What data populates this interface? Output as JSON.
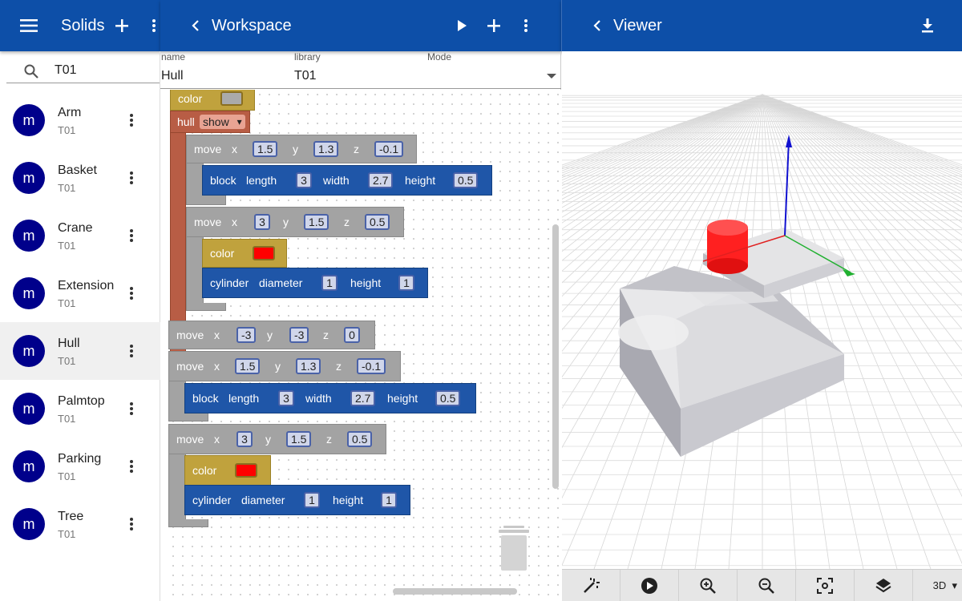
{
  "left": {
    "title": "Solids",
    "search_value": "T01",
    "items": [
      {
        "avatar": "m",
        "name": "Arm",
        "library": "T01"
      },
      {
        "avatar": "m",
        "name": "Basket",
        "library": "T01"
      },
      {
        "avatar": "m",
        "name": "Crane",
        "library": "T01"
      },
      {
        "avatar": "m",
        "name": "Extension",
        "library": "T01"
      },
      {
        "avatar": "m",
        "name": "Hull",
        "library": "T01"
      },
      {
        "avatar": "m",
        "name": "Palmtop",
        "library": "T01"
      },
      {
        "avatar": "m",
        "name": "Parking",
        "library": "T01"
      },
      {
        "avatar": "m",
        "name": "Tree",
        "library": "T01"
      }
    ],
    "selected_item": "Hull"
  },
  "workspace": {
    "title": "Workspace",
    "fields": {
      "name_label": "name",
      "name_value": "Hull",
      "library_label": "library",
      "library_value": "T01",
      "mode_label": "Mode",
      "mode_value": ""
    },
    "blocks": {
      "color": "color",
      "hull": "hull",
      "hull_option": "show",
      "move": "move",
      "block": "block",
      "cylinder": "cylinder",
      "x": "x",
      "y": "y",
      "z": "z",
      "length": "length",
      "width": "width",
      "height": "height",
      "diameter": "diameter",
      "m1": {
        "x": "1.5",
        "y": "1.3",
        "z": "-0.1"
      },
      "b1": {
        "length": "3",
        "width": "2.7",
        "height": "0.5"
      },
      "m2": {
        "x": "3",
        "y": "1.5",
        "z": "0.5"
      },
      "c1": {
        "diameter": "1",
        "height": "1"
      },
      "m3": {
        "x": "-3",
        "y": "-3",
        "z": "0"
      },
      "m4": {
        "x": "1.5",
        "y": "1.3",
        "z": "-0.1"
      },
      "b2": {
        "length": "3",
        "width": "2.7",
        "height": "0.5"
      },
      "m5": {
        "x": "3",
        "y": "1.5",
        "z": "0.5"
      },
      "c2": {
        "diameter": "1",
        "height": "1"
      }
    }
  },
  "viewer": {
    "title": "Viewer",
    "mode": "3D"
  },
  "colors": {
    "appbar": "#0d4fa8",
    "avatar": "#00008b",
    "move_block": "#a3a3a3",
    "shape_block": "#1f56a8",
    "color_block": "#c0a23d",
    "hull_block": "#b85d45"
  }
}
